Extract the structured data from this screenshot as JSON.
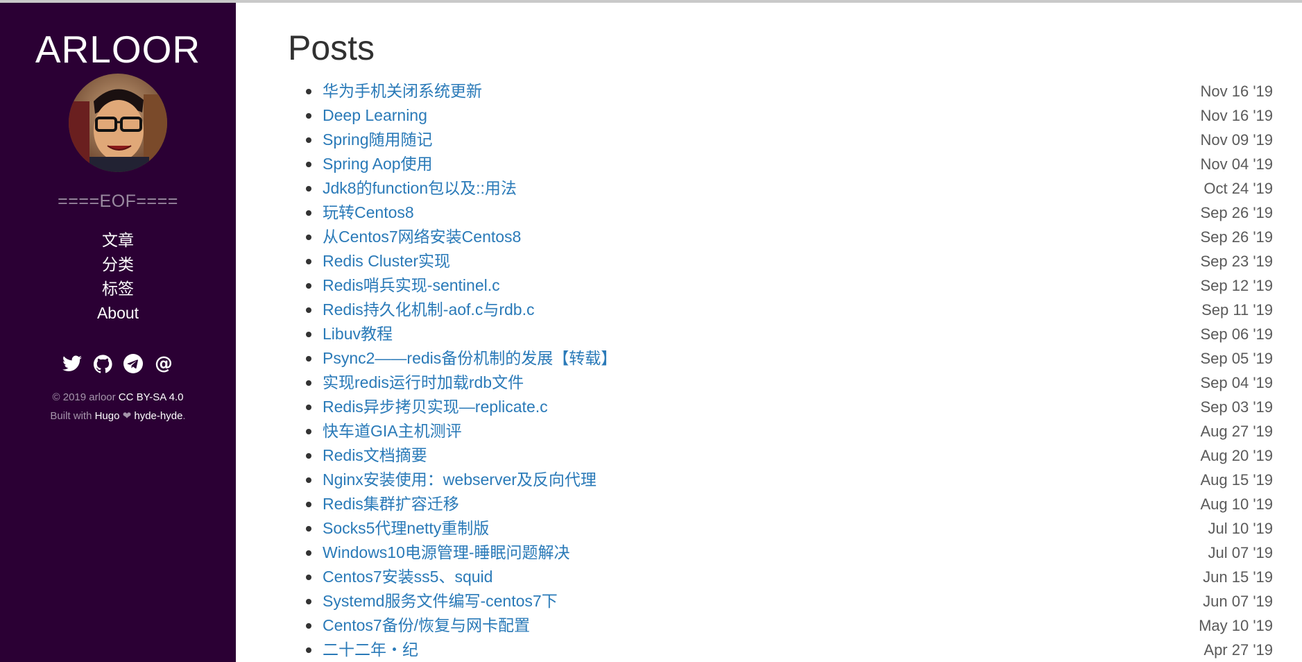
{
  "sidebar": {
    "title": "ARLOOR",
    "tagline": "====EOF====",
    "nav": [
      {
        "label": "文章"
      },
      {
        "label": "分类"
      },
      {
        "label": "标签"
      },
      {
        "label": "About"
      }
    ],
    "social_icons": [
      "twitter-icon",
      "github-icon",
      "telegram-icon",
      "email-icon"
    ],
    "footer": {
      "copyright": "© 2019 arloor ",
      "license": "CC BY-SA 4.0",
      "built_with": "Built with ",
      "hugo": "Hugo",
      "heart": " ❤ ",
      "theme": "hyde-hyde",
      "period": "."
    }
  },
  "main": {
    "title": "Posts",
    "posts": [
      {
        "title": "华为手机关闭系统更新",
        "date": "Nov 16 '19"
      },
      {
        "title": "Deep Learning",
        "date": "Nov 16 '19"
      },
      {
        "title": "Spring随用随记",
        "date": "Nov 09 '19"
      },
      {
        "title": "Spring Aop使用",
        "date": "Nov 04 '19"
      },
      {
        "title": "Jdk8的function包以及::用法",
        "date": "Oct 24 '19"
      },
      {
        "title": "玩转Centos8",
        "date": "Sep 26 '19"
      },
      {
        "title": "从Centos7网络安装Centos8",
        "date": "Sep 26 '19"
      },
      {
        "title": "Redis Cluster实现",
        "date": "Sep 23 '19"
      },
      {
        "title": "Redis哨兵实现-sentinel.c",
        "date": "Sep 12 '19"
      },
      {
        "title": "Redis持久化机制-aof.c与rdb.c",
        "date": "Sep 11 '19"
      },
      {
        "title": "Libuv教程",
        "date": "Sep 06 '19"
      },
      {
        "title": "Psync2——redis备份机制的发展【转载】",
        "date": "Sep 05 '19"
      },
      {
        "title": "实现redis运行时加载rdb文件",
        "date": "Sep 04 '19"
      },
      {
        "title": "Redis异步拷贝实现—replicate.c",
        "date": "Sep 03 '19"
      },
      {
        "title": "快车道GIA主机测评",
        "date": "Aug 27 '19"
      },
      {
        "title": "Redis文档摘要",
        "date": "Aug 20 '19"
      },
      {
        "title": "Nginx安装使用：webserver及反向代理",
        "date": "Aug 15 '19"
      },
      {
        "title": "Redis集群扩容迁移",
        "date": "Aug 10 '19"
      },
      {
        "title": "Socks5代理netty重制版",
        "date": "Jul 10 '19"
      },
      {
        "title": "Windows10电源管理-睡眠问题解决",
        "date": "Jul 07 '19"
      },
      {
        "title": "Centos7安装ss5、squid",
        "date": "Jun 15 '19"
      },
      {
        "title": "Systemd服务文件编写-centos7下",
        "date": "Jun 07 '19"
      },
      {
        "title": "Centos7备份/恢复与网卡配置",
        "date": "May 10 '19"
      },
      {
        "title": "二十二年・纪",
        "date": "Apr 27 '19"
      }
    ]
  },
  "colors": {
    "sidebar_bg": "#2b0034",
    "link": "#2a7ab8",
    "date": "#5a5a5a",
    "heading": "#313131"
  }
}
